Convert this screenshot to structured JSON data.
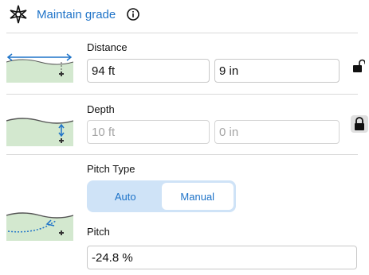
{
  "header": {
    "title": "Maintain grade",
    "logo_icon": "compass-star-icon",
    "info_icon": "info-circle-icon"
  },
  "distance": {
    "label": "Distance",
    "feet_value": "94 ft",
    "inches_value": "9 in",
    "lock_icon": "unlocked-padlock-icon"
  },
  "depth": {
    "label": "Depth",
    "feet_value": "10 ft",
    "inches_value": "0 in",
    "lock_icon": "locked-padlock-icon"
  },
  "pitch_type": {
    "label": "Pitch Type",
    "options": [
      "Auto",
      "Manual"
    ],
    "selected": "Manual"
  },
  "pitch": {
    "label": "Pitch",
    "value": "-24.8 %"
  },
  "colors": {
    "accent": "#1e73c8",
    "ground": "#d3e8cf",
    "segment_bg": "#cfe3f7"
  }
}
